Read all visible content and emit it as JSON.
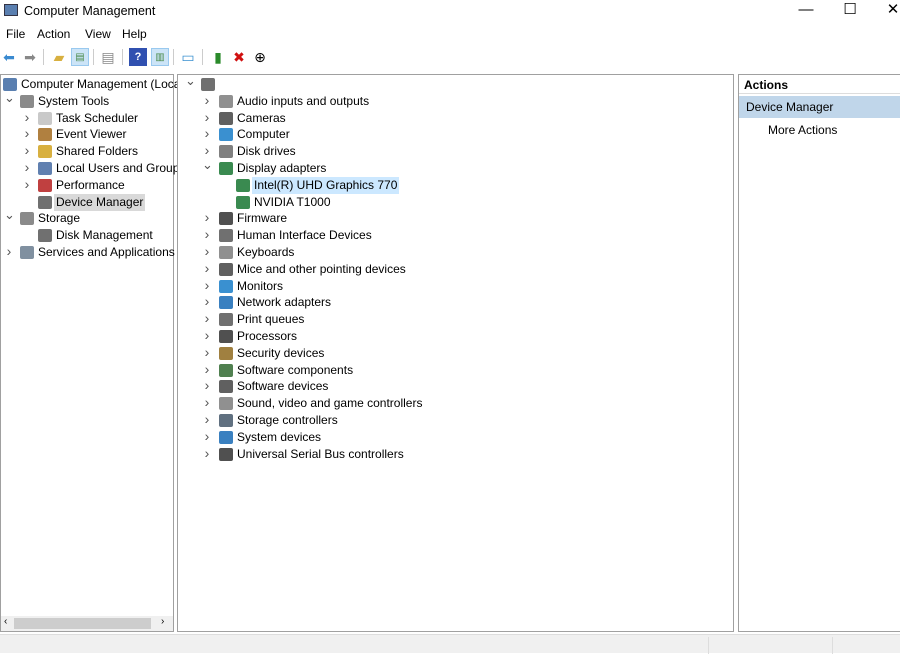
{
  "window": {
    "title": "Computer Management",
    "minimize": "—",
    "maximize": "☐",
    "close": "✕"
  },
  "menu": [
    "File",
    "Action",
    "View",
    "Help"
  ],
  "toolbar": {
    "icons": [
      "back-icon",
      "forward-icon",
      "up-folder-icon",
      "show-hide-tree-icon",
      "properties-icon",
      "help-icon",
      "show-hide-action-pane-icon",
      "monitor-icon",
      "update-driver-icon",
      "uninstall-icon",
      "disable-icon"
    ]
  },
  "left_tree": [
    {
      "label": "Computer Management (Local",
      "level": 0,
      "chev": "",
      "color": "#5a7fb0"
    },
    {
      "label": "System Tools",
      "level": 1,
      "chev": "v",
      "color": "#8a8a8a"
    },
    {
      "label": "Task Scheduler",
      "level": 2,
      "chev": ">",
      "color": "#c9c9c9"
    },
    {
      "label": "Event Viewer",
      "level": 2,
      "chev": ">",
      "color": "#b08040"
    },
    {
      "label": "Shared Folders",
      "level": 2,
      "chev": ">",
      "color": "#d8b040"
    },
    {
      "label": "Local Users and Groups",
      "level": 2,
      "chev": ">",
      "color": "#6080b0"
    },
    {
      "label": "Performance",
      "level": 2,
      "chev": ">",
      "color": "#c04040"
    },
    {
      "label": "Device Manager",
      "level": 2,
      "chev": "",
      "color": "#707070",
      "selected": true
    },
    {
      "label": "Storage",
      "level": 1,
      "chev": "v",
      "color": "#8a8a8a"
    },
    {
      "label": "Disk Management",
      "level": 2,
      "chev": "",
      "color": "#707070"
    },
    {
      "label": "Services and Applications",
      "level": 1,
      "chev": ">",
      "color": "#8090a0"
    }
  ],
  "device_tree": {
    "root": {
      "label": "",
      "chev": "v"
    },
    "categories": [
      {
        "label": "Audio inputs and outputs",
        "chev": ">",
        "color": "#909090"
      },
      {
        "label": "Cameras",
        "chev": ">",
        "color": "#606060"
      },
      {
        "label": "Computer",
        "chev": ">",
        "color": "#3a90d0"
      },
      {
        "label": "Disk drives",
        "chev": ">",
        "color": "#808080"
      },
      {
        "label": "Display adapters",
        "chev": "v",
        "color": "#3a8a50",
        "children": [
          {
            "label": "Intel(R) UHD Graphics 770",
            "selected": true
          },
          {
            "label": "NVIDIA T1000"
          }
        ]
      },
      {
        "label": "Firmware",
        "chev": ">",
        "color": "#505050"
      },
      {
        "label": "Human Interface Devices",
        "chev": ">",
        "color": "#707070"
      },
      {
        "label": "Keyboards",
        "chev": ">",
        "color": "#909090"
      },
      {
        "label": "Mice and other pointing devices",
        "chev": ">",
        "color": "#606060"
      },
      {
        "label": "Monitors",
        "chev": ">",
        "color": "#3a90d0"
      },
      {
        "label": "Network adapters",
        "chev": ">",
        "color": "#3a80c0"
      },
      {
        "label": "Print queues",
        "chev": ">",
        "color": "#707070"
      },
      {
        "label": "Processors",
        "chev": ">",
        "color": "#505050"
      },
      {
        "label": "Security devices",
        "chev": ">",
        "color": "#a08040"
      },
      {
        "label": "Software components",
        "chev": ">",
        "color": "#508050"
      },
      {
        "label": "Software devices",
        "chev": ">",
        "color": "#606060"
      },
      {
        "label": "Sound, video and game controllers",
        "chev": ">",
        "color": "#909090"
      },
      {
        "label": "Storage controllers",
        "chev": ">",
        "color": "#607080"
      },
      {
        "label": "System devices",
        "chev": ">",
        "color": "#3a80c0"
      },
      {
        "label": "Universal Serial Bus controllers",
        "chev": ">",
        "color": "#505050"
      }
    ]
  },
  "actions": {
    "header": "Actions",
    "section": "Device Manager",
    "items": [
      "More Actions"
    ]
  }
}
